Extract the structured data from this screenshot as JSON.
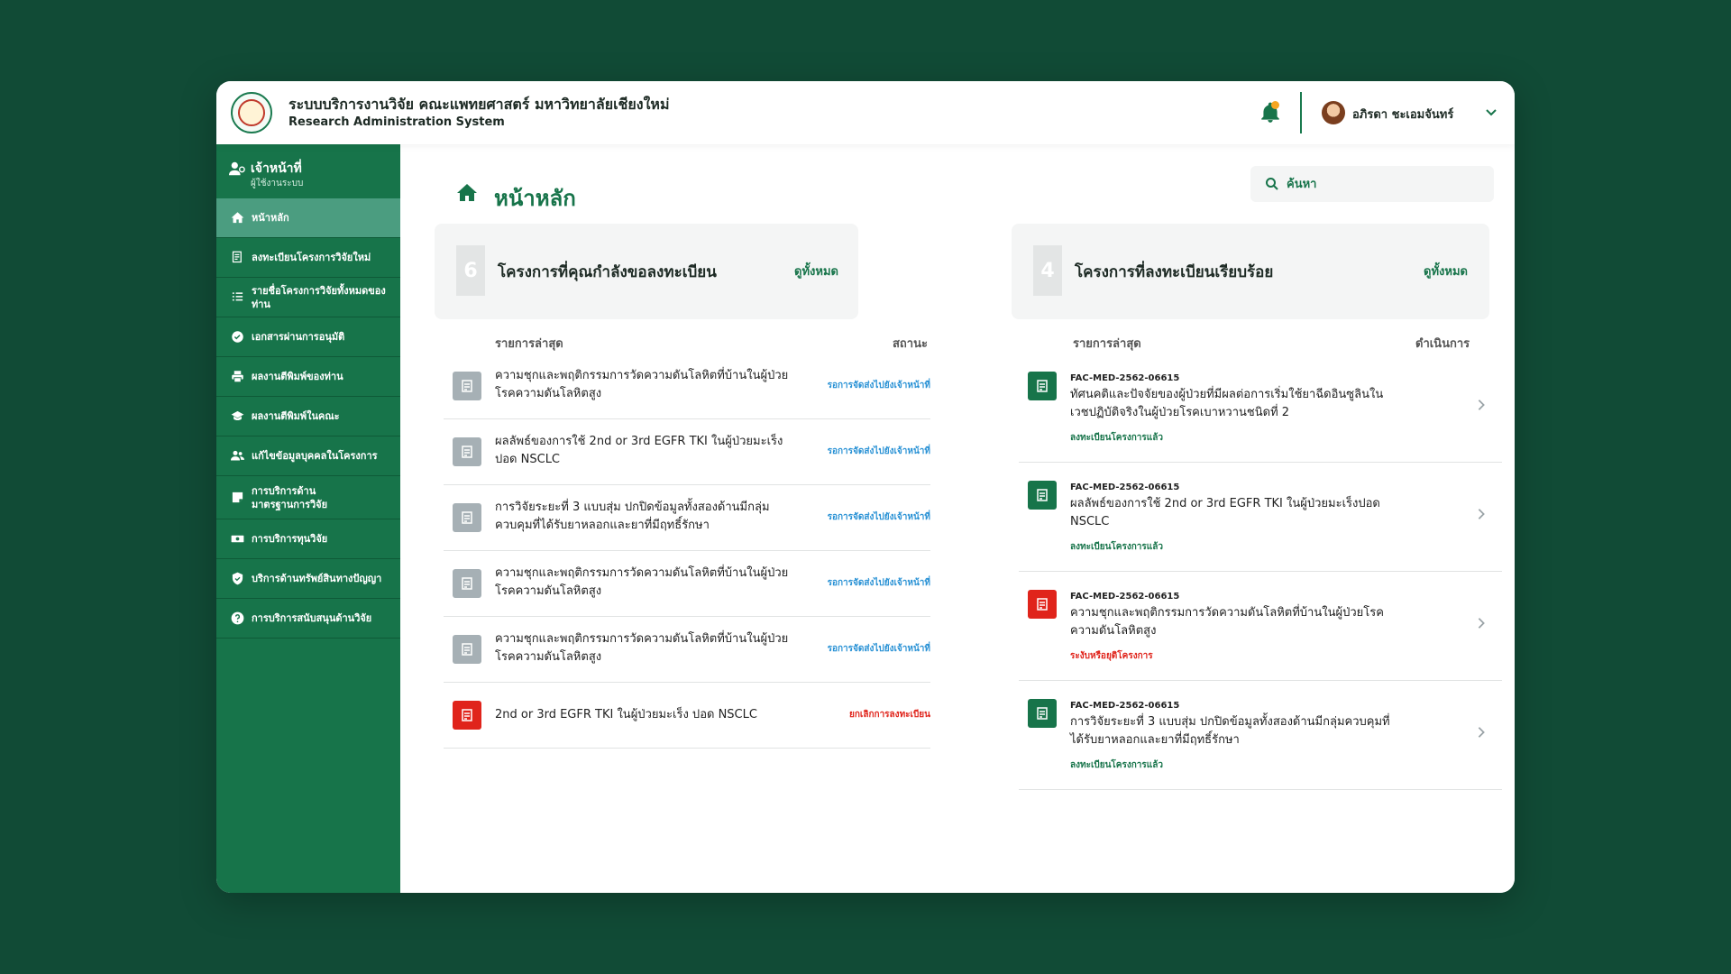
{
  "colors": {
    "brand_green": "#17744a",
    "active_nav": "#4b9d80",
    "status_pending": "#2a92d5",
    "status_cancel": "#e0241b",
    "doc_grey": "#a6b0b5",
    "doc_green": "#17744a",
    "doc_red": "#e0241b",
    "notification_dot": "#f5a623"
  },
  "header": {
    "title_th": "ระบบบริการงานวิจัย คณะแพทยศาสตร์ มหาวิทยาลัยเชียงใหม่",
    "title_en": "Research Administration System",
    "logo_icon": "university-seal-icon",
    "bell_icon": "bell-icon",
    "user_name": "อภิรดา ชะเอมจันทร์",
    "user_menu_icon": "chevron-down-icon"
  },
  "sidebar": {
    "role_title": "เจ้าหน้าที่",
    "role_subtitle": "ผู้ใช้งานระบบ",
    "items": [
      {
        "label": "หน้าหลัก",
        "icon": "home-icon",
        "active": true
      },
      {
        "label": "ลงทะเบียนโครงการวิจัยใหม่",
        "icon": "register-doc-icon"
      },
      {
        "label": "รายชื่อโครงการวิจัยทั้งหมดของท่าน",
        "icon": "list-icon"
      },
      {
        "label": "เอกสารผ่านการอนุมัติ",
        "icon": "check-circle-icon"
      },
      {
        "label": "ผลงานตีพิมพ์ของท่าน",
        "icon": "print-icon"
      },
      {
        "label": "ผลงานตีพิมพ์ในคณะ",
        "icon": "graduation-cap-icon"
      },
      {
        "label": "แก้ไขข้อมูลบุคคลในโครงการ",
        "icon": "users-icon"
      },
      {
        "label": "การบริการด้าน\nมาตรฐานการวิจัย",
        "icon": "note-icon"
      },
      {
        "label": "การบริการทุนวิจัย",
        "icon": "money-icon"
      },
      {
        "label": "บริการด้านทรัพย์สินทางปัญญา",
        "icon": "shield-icon"
      },
      {
        "label": "การบริการสนับสนุนด้านวิจัย",
        "icon": "question-icon"
      }
    ]
  },
  "main": {
    "page_title": "หน้าหลัก",
    "search_placeholder": "ค้นหา",
    "pending": {
      "count": "6",
      "title": "โครงการที่คุณกำลังขอลงทะเบียน",
      "see_all": "ดูทั้งหมด",
      "col_latest": "รายการล่าสุด",
      "col_status": "สถานะ",
      "rows": [
        {
          "title": "ความชุกและพฤติกรรมการวัดความดันโลหิตที่บ้านในผู้ป่วยโรคความดันโลหิตสูง",
          "status": "รอการจัดส่งไปยังเจ้าหน้าที่",
          "kind": "pending"
        },
        {
          "title": "ผลลัพธ์ของการใช้ 2nd or 3rd EGFR TKI ในผู้ป่วยมะเร็งปอด NSCLC",
          "status": "รอการจัดส่งไปยังเจ้าหน้าที่",
          "kind": "pending"
        },
        {
          "title": "การวิจัยระยะที่ 3 แบบสุ่ม ปกปิดข้อมูลทั้งสองด้านมีกลุ่มควบคุมที่ได้รับยาหลอกและยาที่มีฤทธิ์รักษา",
          "status": "รอการจัดส่งไปยังเจ้าหน้าที่",
          "kind": "pending"
        },
        {
          "title": "ความชุกและพฤติกรรมการวัดความดันโลหิตที่บ้านในผู้ป่วยโรคความดันโลหิตสูง",
          "status": "รอการจัดส่งไปยังเจ้าหน้าที่",
          "kind": "pending"
        },
        {
          "title": "ความชุกและพฤติกรรมการวัดความดันโลหิตที่บ้านในผู้ป่วยโรคความดันโลหิตสูง",
          "status": "รอการจัดส่งไปยังเจ้าหน้าที่",
          "kind": "pending"
        },
        {
          "title": "2nd or 3rd EGFR TKI ในผู้ป่วยมะเร็ง ปอด NSCLC",
          "status": "ยกเลิกการลงทะเบียน",
          "kind": "cancel"
        }
      ]
    },
    "registered": {
      "count": "4",
      "title": "โครงการที่ลงทะเบียนเรียบร้อย",
      "see_all": "ดูทั้งหมด",
      "col_latest": "รายการล่าสุด",
      "col_action": "ดำเนินการ",
      "rows": [
        {
          "code": "FAC-MED-2562-06615",
          "title": "ทัศนคติและปัจจัยของผู้ป่วยที่มีผลต่อการเริ่มใช้ยาฉีดอินซูลินในเวชปฏิบัติจริงในผู้ป่วยโรคเบาหวานชนิดที่ 2",
          "status": "ลงทะเบียนโครงการแล้ว",
          "kind": "ok"
        },
        {
          "code": "FAC-MED-2562-06615",
          "title": "ผลลัพธ์ของการใช้ 2nd or 3rd EGFR TKI ในผู้ป่วยมะเร็งปอด NSCLC",
          "status": "ลงทะเบียนโครงการแล้ว",
          "kind": "ok"
        },
        {
          "code": "FAC-MED-2562-06615",
          "title": "ความชุกและพฤติกรรมการวัดความดันโลหิตที่บ้านในผู้ป่วยโรคความดันโลหิตสูง",
          "status": "ระงับหรือยุติโครงการ",
          "kind": "suspended"
        },
        {
          "code": "FAC-MED-2562-06615",
          "title": "การวิจัยระยะที่ 3 แบบสุ่ม ปกปิดข้อมูลทั้งสองด้านมีกลุ่มควบคุมที่ได้รับยาหลอกและยาที่มีฤทธิ์รักษา",
          "status": "ลงทะเบียนโครงการแล้ว",
          "kind": "ok"
        }
      ]
    }
  }
}
